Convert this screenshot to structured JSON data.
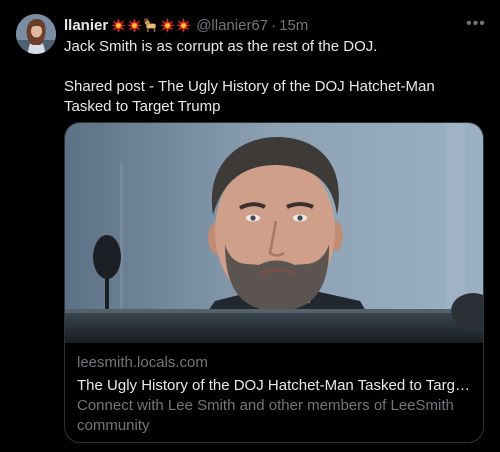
{
  "post": {
    "author_name": "llanier",
    "emojis": [
      "collision-icon",
      "collision-icon",
      "ram-icon",
      "collision-icon",
      "collision-icon"
    ],
    "handle": "@llanier67",
    "separator": "·",
    "time": "15m",
    "more_label": "•••",
    "text_line1": "Jack Smith is as corrupt as the rest of the DOJ.",
    "text_line2": "Shared post - The Ugly History of the DOJ Hatchet-Man Tasked to Target Trump"
  },
  "card": {
    "domain": "leesmith.locals.com",
    "title": "The Ugly History of the DOJ Hatchet-Man Tasked to Target T...",
    "description": "Connect with Lee Smith and other members of LeeSmith community"
  },
  "colors": {
    "background": "#000000",
    "text": "#e7e9ea",
    "muted": "#71767b",
    "border": "#2f3336"
  }
}
